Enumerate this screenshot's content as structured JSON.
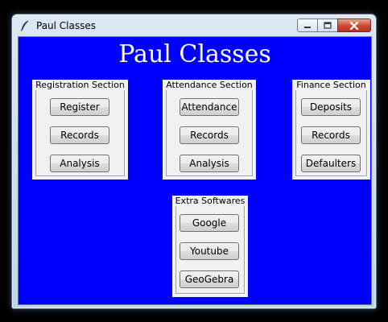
{
  "window": {
    "title": "Paul Classes",
    "controls": [
      "minimize",
      "maximize",
      "close"
    ]
  },
  "app": {
    "heading": "Paul Classes",
    "background_color": "#0000ff"
  },
  "sections": {
    "registration": {
      "title": "Registration Section",
      "buttons": [
        "Register",
        "Records",
        "Analysis"
      ]
    },
    "attendance": {
      "title": "Attendance Section",
      "buttons": [
        "Attendance",
        "Records",
        "Analysis"
      ]
    },
    "finance": {
      "title": "Finance Section",
      "buttons": [
        "Deposits",
        "Records",
        "Defaulters"
      ]
    },
    "extra": {
      "title": "Extra Softwares",
      "buttons": [
        "Google",
        "Youtube",
        "GeoGebra"
      ]
    }
  }
}
